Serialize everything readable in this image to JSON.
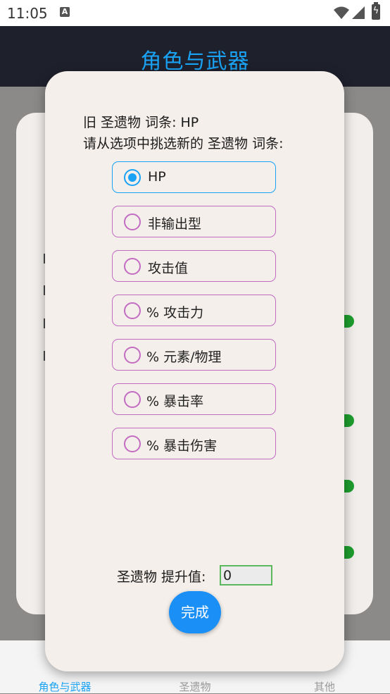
{
  "status_bar": {
    "time": "11:05",
    "notification_icon": "A"
  },
  "app_bar": {
    "title": "角色与武器"
  },
  "dialog": {
    "old_affix_line": "旧 圣遗物 词条: HP",
    "prompt_line": "请从选项中挑选新的 圣遗物 词条:",
    "options": [
      {
        "label": "HP",
        "selected": true
      },
      {
        "label": "非输出型",
        "selected": false
      },
      {
        "label": "攻击值",
        "selected": false
      },
      {
        "label": "% 攻击力",
        "selected": false
      },
      {
        "label": "% 元素/物理",
        "selected": false
      },
      {
        "label": "% 暴击率",
        "selected": false
      },
      {
        "label": "% 暴击伤害",
        "selected": false
      }
    ],
    "boost_label": "圣遗物 提升值:",
    "boost_value": "0",
    "done_label": "完成"
  },
  "bottom_nav": {
    "items": [
      {
        "label": "角色与武器",
        "active": true
      },
      {
        "label": "圣遗物",
        "active": false
      },
      {
        "label": "其他",
        "active": false
      }
    ]
  },
  "colors": {
    "accent": "#1aa3f5",
    "option_border": "#c26cc2",
    "app_bar": "#1e202c",
    "dialog_bg": "#f4efeb",
    "input_border": "#5cb85c"
  }
}
